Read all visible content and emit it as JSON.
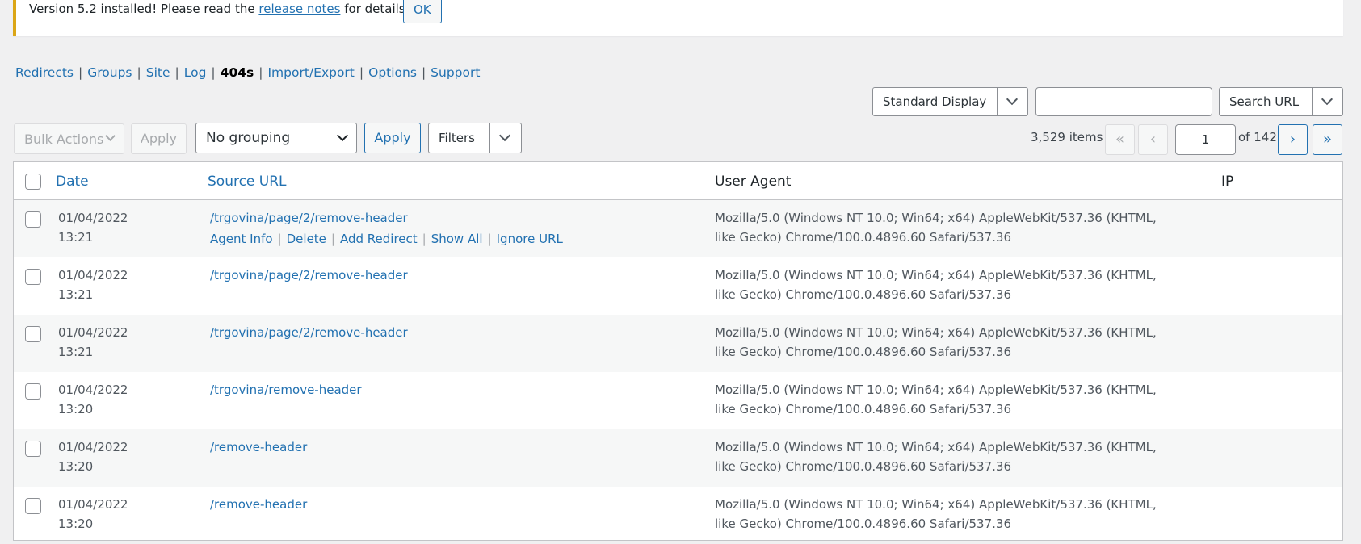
{
  "notice": {
    "text_before": "Version 5.2 installed! Please read the",
    "link": "release notes",
    "text_after": "for details.",
    "ok": "OK"
  },
  "nav": [
    {
      "label": "Redirects",
      "current": false
    },
    {
      "label": "Groups",
      "current": false
    },
    {
      "label": "Site",
      "current": false
    },
    {
      "label": "Log",
      "current": false
    },
    {
      "label": "404s",
      "current": true
    },
    {
      "label": "Import/Export",
      "current": false
    },
    {
      "label": "Options",
      "current": false
    },
    {
      "label": "Support",
      "current": false
    }
  ],
  "top_controls": {
    "display_select": "Standard Display",
    "search_value": "",
    "search_select": "Search URL"
  },
  "toolbar": {
    "bulk_actions": "Bulk Actions",
    "apply1": "Apply",
    "grouping": "No grouping",
    "apply2": "Apply",
    "filters": "Filters"
  },
  "pagination": {
    "items": "3,529 items",
    "first": "«",
    "prev": "‹",
    "current_page": "1",
    "of": "of 142",
    "next": "›",
    "last": "»"
  },
  "table": {
    "headers": {
      "date": "Date",
      "source": "Source URL",
      "agent": "User Agent",
      "ip": "IP"
    },
    "row_actions": [
      "Agent Info",
      "Delete",
      "Add Redirect",
      "Show All",
      "Ignore URL"
    ],
    "rows": [
      {
        "date": "01/04/2022",
        "time": "13:21",
        "url": "/trgovina/page/2/remove-header",
        "agent": "Mozilla/5.0 (Windows NT 10.0; Win64; x64) AppleWebKit/537.36 (KHTML, like Gecko) Chrome/100.0.4896.60 Safari/537.36"
      },
      {
        "date": "01/04/2022",
        "time": "13:21",
        "url": "/trgovina/page/2/remove-header",
        "agent": "Mozilla/5.0 (Windows NT 10.0; Win64; x64) AppleWebKit/537.36 (KHTML, like Gecko) Chrome/100.0.4896.60 Safari/537.36"
      },
      {
        "date": "01/04/2022",
        "time": "13:21",
        "url": "/trgovina/page/2/remove-header",
        "agent": "Mozilla/5.0 (Windows NT 10.0; Win64; x64) AppleWebKit/537.36 (KHTML, like Gecko) Chrome/100.0.4896.60 Safari/537.36"
      },
      {
        "date": "01/04/2022",
        "time": "13:20",
        "url": "/trgovina/remove-header",
        "agent": "Mozilla/5.0 (Windows NT 10.0; Win64; x64) AppleWebKit/537.36 (KHTML, like Gecko) Chrome/100.0.4896.60 Safari/537.36"
      },
      {
        "date": "01/04/2022",
        "time": "13:20",
        "url": "/remove-header",
        "agent": "Mozilla/5.0 (Windows NT 10.0; Win64; x64) AppleWebKit/537.36 (KHTML, like Gecko) Chrome/100.0.4896.60 Safari/537.36"
      },
      {
        "date": "01/04/2022",
        "time": "13:20",
        "url": "/remove-header",
        "agent": "Mozilla/5.0 (Windows NT 10.0; Win64; x64) AppleWebKit/537.36 (KHTML, like Gecko) Chrome/100.0.4896.60 Safari/537.36"
      }
    ]
  }
}
